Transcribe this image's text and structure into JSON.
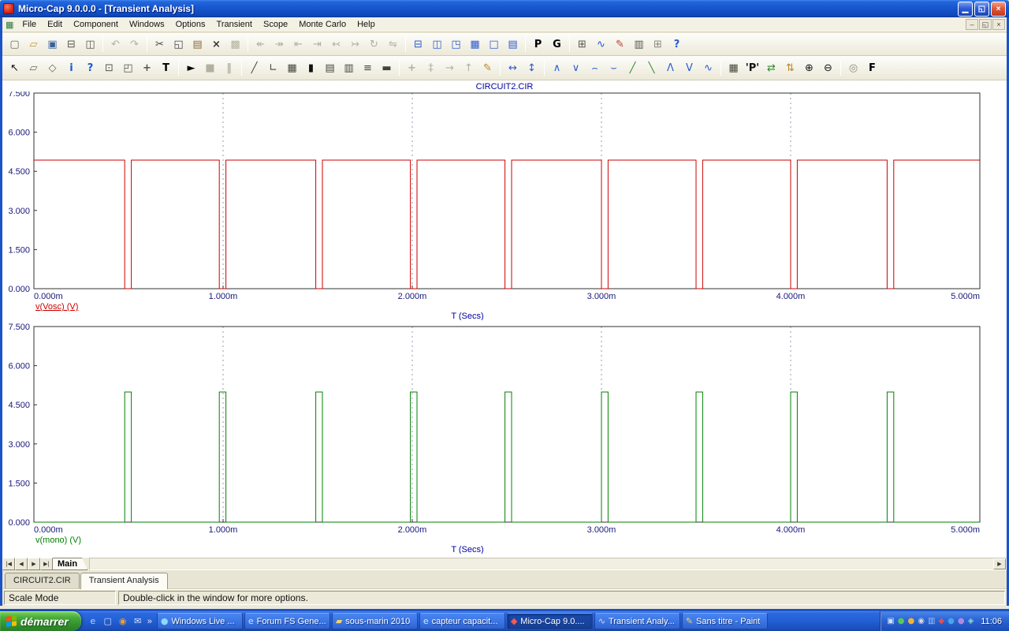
{
  "window": {
    "title": "Micro-Cap 9.0.0.0 - [Transient Analysis]",
    "controls": [
      {
        "name": "minimize-button",
        "glyph": "▁"
      },
      {
        "name": "restore-button",
        "glyph": "◱"
      },
      {
        "name": "close-button",
        "glyph": "×"
      }
    ]
  },
  "menu": {
    "items": [
      "File",
      "Edit",
      "Component",
      "Windows",
      "Options",
      "Transient",
      "Scope",
      "Monte Carlo",
      "Help"
    ],
    "mdi_controls": [
      {
        "name": "mdi-minimize-button",
        "glyph": "–"
      },
      {
        "name": "mdi-restore-button",
        "glyph": "◱"
      },
      {
        "name": "mdi-close-button",
        "glyph": "×"
      }
    ]
  },
  "toolbar_main": {
    "icons": [
      {
        "name": "new-file-icon",
        "glyph": "▢",
        "color": "#6a6a5a"
      },
      {
        "name": "open-file-icon",
        "glyph": "▱",
        "color": "#c8983a"
      },
      {
        "name": "save-icon",
        "glyph": "▣",
        "color": "#38609a"
      },
      {
        "name": "print-icon",
        "glyph": "⊟",
        "color": "#55554a"
      },
      {
        "name": "print-preview-icon",
        "glyph": "◫",
        "color": "#55554a"
      },
      {
        "sep": true
      },
      {
        "name": "undo-icon",
        "glyph": "↶",
        "disabled": true
      },
      {
        "name": "redo-icon",
        "glyph": "↷",
        "disabled": true
      },
      {
        "sep": true
      },
      {
        "name": "cut-icon",
        "glyph": "✂",
        "color": "#44444a"
      },
      {
        "name": "copy-icon",
        "glyph": "◱",
        "color": "#44444a"
      },
      {
        "name": "paste-icon",
        "glyph": "▤",
        "color": "#8a6a3a"
      },
      {
        "name": "clear-icon",
        "glyph": "×",
        "bold": true,
        "color": "#333333"
      },
      {
        "name": "select-all-icon",
        "glyph": "▩",
        "disabled": true
      },
      {
        "sep": true
      },
      {
        "name": "step-back-icon",
        "glyph": "↞",
        "disabled": true
      },
      {
        "name": "step-forward-icon",
        "glyph": "↠",
        "disabled": true
      },
      {
        "name": "goto-start-icon",
        "glyph": "⇤",
        "disabled": true
      },
      {
        "name": "goto-end-icon",
        "glyph": "⇥",
        "disabled": true
      },
      {
        "name": "shift-left-icon",
        "glyph": "↢",
        "disabled": true
      },
      {
        "name": "shift-right-icon",
        "glyph": "↣",
        "disabled": true
      },
      {
        "name": "rotate-icon",
        "glyph": "↻",
        "disabled": true
      },
      {
        "name": "mirror-icon",
        "glyph": "⇋",
        "disabled": true
      },
      {
        "sep": true
      },
      {
        "name": "split-horizontal-icon",
        "glyph": "⊟",
        "color": "#2a5ad0"
      },
      {
        "name": "split-vertical-icon",
        "glyph": "◫",
        "color": "#2a5ad0"
      },
      {
        "name": "cascade-windows-icon",
        "glyph": "◳",
        "color": "#2a5ad0"
      },
      {
        "name": "tile-windows-icon",
        "glyph": "▦",
        "color": "#2a5ad0"
      },
      {
        "name": "maximize-window-icon",
        "glyph": "□",
        "color": "#2a5ad0"
      },
      {
        "name": "numeric-output-window-icon",
        "glyph": "▤",
        "color": "#2a5ad0"
      },
      {
        "sep": true
      },
      {
        "name": "p-key-button",
        "glyph": "P",
        "bold": true,
        "color": "#000000"
      },
      {
        "name": "g-key-button",
        "glyph": "G",
        "bold": true,
        "color": "#000000"
      },
      {
        "sep": true
      },
      {
        "name": "component-editor-icon",
        "glyph": "⊞",
        "color": "#55554a"
      },
      {
        "name": "shape-editor-icon",
        "glyph": "∿",
        "color": "#2a5ad0"
      },
      {
        "name": "probe-pen-icon",
        "glyph": "✎",
        "color": "#c03a2a"
      },
      {
        "name": "model-program-icon",
        "glyph": "▥",
        "color": "#55554a"
      },
      {
        "name": "calculator-icon",
        "glyph": "⊞",
        "color": "#8a8a7a"
      },
      {
        "name": "help-topics-icon",
        "glyph": "?",
        "bold": true,
        "color": "#2a5ad0"
      }
    ]
  },
  "toolbar_analysis": {
    "icons": [
      {
        "name": "select-mode-icon",
        "glyph": "↖",
        "color": "#111111"
      },
      {
        "name": "graphics-mode-icon",
        "glyph": "▱",
        "color": "#6a6a5a"
      },
      {
        "name": "polygon-mode-icon",
        "glyph": "◇",
        "color": "#6a6a5a"
      },
      {
        "name": "info-mode-icon",
        "glyph": "i",
        "bold": true,
        "color": "#1a5ad0"
      },
      {
        "name": "help-mode-icon",
        "glyph": "?",
        "bold": true,
        "color": "#1a5ad0"
      },
      {
        "name": "region-select-icon",
        "glyph": "⊡",
        "color": "#55554a"
      },
      {
        "name": "scale-mode-icon",
        "glyph": "◰",
        "color": "#55554a"
      },
      {
        "name": "cursor-mode-icon",
        "glyph": "+",
        "bold": true,
        "color": "#55554a"
      },
      {
        "name": "text-mode-icon",
        "glyph": "T",
        "bold": true,
        "color": "#000000"
      },
      {
        "sep": true
      },
      {
        "name": "run-button",
        "glyph": "►",
        "color": "#000000"
      },
      {
        "name": "stop-button",
        "glyph": "■",
        "disabled": true
      },
      {
        "name": "pause-button",
        "glyph": "‖",
        "bold": true,
        "disabled": true
      },
      {
        "sep": true
      },
      {
        "name": "line-mode-icon",
        "glyph": "╱",
        "color": "#44443a"
      },
      {
        "name": "wire-mode-icon",
        "glyph": "∟",
        "color": "#44443a"
      },
      {
        "name": "data-points-icon",
        "glyph": "▦",
        "color": "#44443a"
      },
      {
        "name": "black-rectangle-icon",
        "glyph": "▮",
        "color": "#111111"
      },
      {
        "name": "grid-icon",
        "glyph": "▤",
        "color": "#44443a"
      },
      {
        "name": "bar-chart-icon",
        "glyph": "▥",
        "color": "#44443a"
      },
      {
        "name": "horizontal-lines-icon",
        "glyph": "≡",
        "color": "#44443a"
      },
      {
        "name": "baseline-icon",
        "glyph": "▬",
        "color": "#44443a"
      },
      {
        "sep": true
      },
      {
        "name": "horizontal-cursor-icon",
        "glyph": "+",
        "bold": true,
        "disabled": true
      },
      {
        "name": "vertical-cursor-icon",
        "glyph": "‡",
        "disabled": true
      },
      {
        "name": "go-to-x-icon",
        "glyph": "→",
        "disabled": true
      },
      {
        "name": "go-to-y-icon",
        "glyph": "↑",
        "disabled": true
      },
      {
        "name": "tag-text-icon",
        "glyph": "✎",
        "color": "#b8862a"
      },
      {
        "sep": true
      },
      {
        "name": "align-cursors-horizontal-icon",
        "glyph": "↔",
        "color": "#2a5ad0"
      },
      {
        "name": "align-cursors-vertical-icon",
        "glyph": "↕",
        "color": "#2a5ad0"
      },
      {
        "sep": true
      },
      {
        "name": "peak-icon",
        "glyph": "∧",
        "color": "#2a5ad0"
      },
      {
        "name": "valley-icon",
        "glyph": "∨",
        "color": "#2a5ad0"
      },
      {
        "name": "high-icon",
        "glyph": "⌢",
        "color": "#2a5ad0"
      },
      {
        "name": "low-icon",
        "glyph": "⌣",
        "color": "#2a5ad0"
      },
      {
        "name": "rise-edge-icon",
        "glyph": "╱",
        "color": "#2a8a2a"
      },
      {
        "name": "fall-edge-icon",
        "glyph": "╲",
        "color": "#2a8a2a"
      },
      {
        "name": "top-icon",
        "glyph": "Λ",
        "color": "#2a5ad0"
      },
      {
        "name": "bottom-icon",
        "glyph": "V",
        "color": "#2a5ad0"
      },
      {
        "name": "waveform-icon",
        "glyph": "∿",
        "color": "#2a5ad0"
      },
      {
        "sep": true
      },
      {
        "name": "numeric-output-icon",
        "glyph": "▦",
        "color": "#44443a"
      },
      {
        "name": "p-cursor-icon",
        "glyph": "'P'",
        "bold": true,
        "color": "#111111"
      },
      {
        "name": "normalize-x-icon",
        "glyph": "⇄",
        "color": "#2a8a2a"
      },
      {
        "name": "normalize-y-icon",
        "glyph": "⇅",
        "color": "#b8862a"
      },
      {
        "name": "zoom-in-icon",
        "glyph": "⊕",
        "color": "#111111"
      },
      {
        "name": "zoom-out-icon",
        "glyph": "⊖",
        "color": "#111111"
      },
      {
        "sep": true
      },
      {
        "name": "properties-icon",
        "glyph": "◎",
        "color": "#8a8a7a"
      },
      {
        "name": "font-button",
        "glyph": "F",
        "bold": true,
        "color": "#000000"
      }
    ]
  },
  "chart_data": [
    {
      "type": "line",
      "title": "CIRCUIT2.CIR",
      "trace": "v(Vosc) (V)",
      "underline": true,
      "color": "#cc0000",
      "label_color": "#18187c",
      "xlabel": "T (Secs)",
      "xlim_ms": [
        0,
        5
      ],
      "ylim": [
        0,
        7.5
      ],
      "x_ticks": [
        "0.000m",
        "1.000m",
        "2.000m",
        "3.000m",
        "4.000m",
        "5.000m"
      ],
      "y_ticks": [
        "7.500",
        "6.000",
        "4.500",
        "3.000",
        "1.500",
        "0.000"
      ],
      "grid_x_ms": [
        1,
        2,
        3,
        4
      ],
      "waveform": {
        "kind": "pulse-low",
        "base_level": 4.93,
        "pulse_level": 0,
        "pulse_times_ms": [
          0.48,
          0.98,
          1.49,
          1.99,
          2.49,
          3.0,
          3.5,
          4.0,
          4.51
        ],
        "pulse_width_ms": 0.035
      }
    },
    {
      "type": "line",
      "title": "",
      "trace": "v(mono) (V)",
      "underline": false,
      "color": "#008000",
      "label_color": "#18187c",
      "xlabel": "T (Secs)",
      "xlim_ms": [
        0,
        5
      ],
      "ylim": [
        0,
        7.5
      ],
      "x_ticks": [
        "0.000m",
        "1.000m",
        "2.000m",
        "3.000m",
        "4.000m",
        "5.000m"
      ],
      "y_ticks": [
        "7.500",
        "6.000",
        "4.500",
        "3.000",
        "1.500",
        "0.000"
      ],
      "grid_x_ms": [
        1,
        2,
        3,
        4
      ],
      "waveform": {
        "kind": "pulse-high",
        "base_level": 0,
        "pulse_level": 4.99,
        "pulse_times_ms": [
          0.48,
          0.98,
          1.49,
          1.99,
          2.49,
          3.0,
          3.5,
          4.0,
          4.51
        ],
        "pulse_width_ms": 0.035
      }
    }
  ],
  "sheet": {
    "nav": [
      {
        "name": "first-sheet-button",
        "glyph": "|◀"
      },
      {
        "name": "prev-sheet-button",
        "glyph": "◀"
      },
      {
        "name": "next-sheet-button",
        "glyph": "▶"
      },
      {
        "name": "last-sheet-button",
        "glyph": "▶|"
      }
    ],
    "main_label": "Main",
    "scroll_right_glyph": "▶"
  },
  "tabs": [
    {
      "label": "CIRCUIT2.CIR",
      "active": false
    },
    {
      "label": "Transient Analysis",
      "active": true
    }
  ],
  "status": {
    "left": "Scale Mode",
    "message": "Double-click in the window for more options."
  },
  "taskbar": {
    "start_label": "démarrer",
    "flag_colors": [
      "#f65314",
      "#7cbb00",
      "#00a1f1",
      "#ffbb00"
    ],
    "quick_launch": [
      {
        "name": "internet-explorer-icon",
        "glyph": "e",
        "color": "#bcd8f8"
      },
      {
        "name": "show-desktop-icon",
        "glyph": "▢",
        "color": "#cfe0f8"
      },
      {
        "name": "media-player-icon",
        "glyph": "◉",
        "color": "#f0a030"
      },
      {
        "name": "outlook-icon",
        "glyph": "✉",
        "color": "#d8e8ff"
      }
    ],
    "overflow_glyph": "»",
    "tasks": [
      {
        "label": "Windows Live ...",
        "glyph": "●",
        "icon_color": "#8fd8f8",
        "active": false
      },
      {
        "label": "Forum FS Gene...",
        "glyph": "e",
        "icon_color": "#cfe2ff",
        "active": false
      },
      {
        "label": "sous-marin 2010",
        "glyph": "▰",
        "icon_color": "#f2d269",
        "active": false
      },
      {
        "label": "capteur capacit...",
        "glyph": "e",
        "icon_color": "#cfe2ff",
        "active": false
      },
      {
        "label": "Micro-Cap 9.0....",
        "glyph": "◆",
        "icon_color": "#ff5a4a",
        "active": true
      },
      {
        "label": "Transient Analy...",
        "glyph": "∿",
        "icon_color": "#d8d8d8",
        "active": false
      },
      {
        "label": "Sans titre - Paint",
        "glyph": "✎",
        "icon_color": "#f2d269",
        "active": false
      }
    ],
    "tray_icons": [
      {
        "name": "language-indicator",
        "glyph": "▣",
        "color": "#cfe0f8"
      },
      {
        "name": "messenger-tray-icon",
        "glyph": "●",
        "color": "#58c858"
      },
      {
        "name": "update-tray-icon",
        "glyph": "●",
        "color": "#f2b430"
      },
      {
        "name": "volume-tray-icon",
        "glyph": "◉",
        "color": "#d8d8d8"
      },
      {
        "name": "network-tray-icon",
        "glyph": "▥",
        "color": "#9fc3f8"
      },
      {
        "name": "antivirus-tray-icon",
        "glyph": "◆",
        "color": "#e05050"
      },
      {
        "name": "graphics-tray-icon",
        "glyph": "●",
        "color": "#4aa3e8"
      },
      {
        "name": "scheduler-tray-icon",
        "glyph": "●",
        "color": "#b08ae0"
      },
      {
        "name": "usb-tray-icon",
        "glyph": "◈",
        "color": "#8fd8c8"
      }
    ],
    "tray_time": "11:06"
  }
}
